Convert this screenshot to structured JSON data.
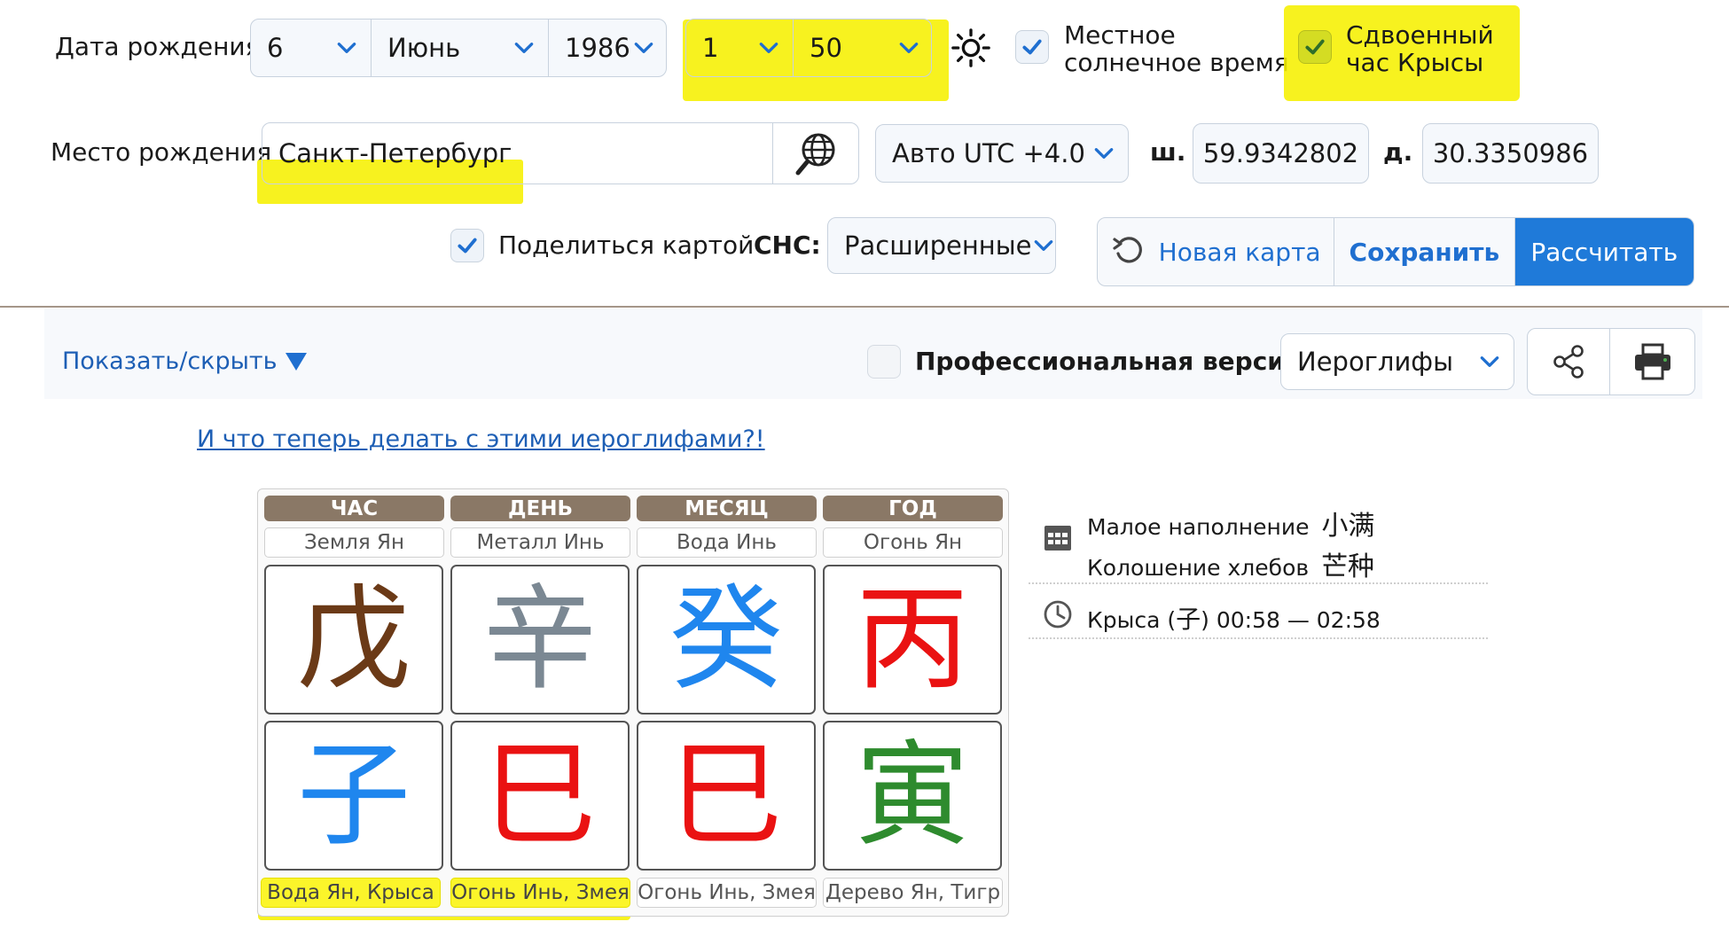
{
  "birth_date": {
    "label": "Дата рождения",
    "day": "6",
    "month": "Июнь",
    "year": "1986",
    "hour": "1",
    "minute": "50"
  },
  "options": {
    "local_solar_time": {
      "checked": true,
      "line1": "Местное",
      "line2": "солнечное время"
    },
    "double_rat_hour": {
      "checked": true,
      "line1": "Сдвоенный",
      "line2": "час Крысы"
    }
  },
  "birth_place": {
    "label": "Место рождения",
    "city": "Санкт-Петербург",
    "timezone": "Авто UTC +4.0",
    "lat_label": "ш.",
    "latitude": "59.9342802",
    "lon_label": "д.",
    "longitude": "30.3350986"
  },
  "share": {
    "checked": true,
    "label": "Поделиться картой"
  },
  "hidden_stems": {
    "label": "СНС:",
    "value": "Расширенные"
  },
  "actions": {
    "new_chart": "Новая карта",
    "save": "Сохранить",
    "calculate": "Рассчитать"
  },
  "toolbar": {
    "show_hide": "Показать/скрыть",
    "pro_version": {
      "checked": false,
      "label": "Профессиональная версия"
    },
    "display_mode": "Иероглифы"
  },
  "help_link": "И что теперь делать с этими иероглифами?!",
  "pillars": [
    {
      "header": "ЧАС",
      "stem_element": "Земля Ян",
      "stem": "戊",
      "stem_color": "#6b3a17",
      "branch": "子",
      "branch_color": "#1f86ee",
      "branch_element": "Вода Ян, Крыса",
      "highlight": true
    },
    {
      "header": "ДЕНЬ",
      "stem_element": "Металл Инь",
      "stem": "辛",
      "stem_color": "#7b8893",
      "branch": "巳",
      "branch_color": "#ea1212",
      "branch_element": "Огонь Инь, Змея",
      "highlight": true
    },
    {
      "header": "МЕСЯЦ",
      "stem_element": "Вода Инь",
      "stem": "癸",
      "stem_color": "#1f86ee",
      "branch": "巳",
      "branch_color": "#ea1212",
      "branch_element": "Огонь Инь, Змея",
      "highlight": false
    },
    {
      "header": "ГОД",
      "stem_element": "Огонь Ян",
      "stem": "丙",
      "stem_color": "#ea1212",
      "branch": "寅",
      "branch_color": "#2e8b2e",
      "branch_element": "Дерево Ян, Тигр",
      "highlight": false
    }
  ],
  "solar_terms": [
    {
      "name": "Малое наполнение",
      "chars": "小满"
    },
    {
      "name": "Колошение хлебов",
      "chars": "芒种"
    }
  ],
  "hour_info": {
    "prefix": "Крыса (",
    "char": "子",
    "suffix": ") 00:58 — 02:58"
  },
  "icons": {
    "chevron": "chevron-down-icon",
    "sun": "sun-icon",
    "check": "check-icon",
    "globe": "globe-search-icon",
    "refresh": "refresh-icon",
    "share": "share-icon",
    "print": "print-icon",
    "calendar": "calendar-grid-icon",
    "clock": "clock-icon",
    "triangle": "triangle-down-icon"
  },
  "colors": {
    "accent_blue": "#1f7ad9",
    "link_blue": "#1e5fb5",
    "highlight_yellow": "#f6f000",
    "pillar_header": "#8a7866"
  }
}
